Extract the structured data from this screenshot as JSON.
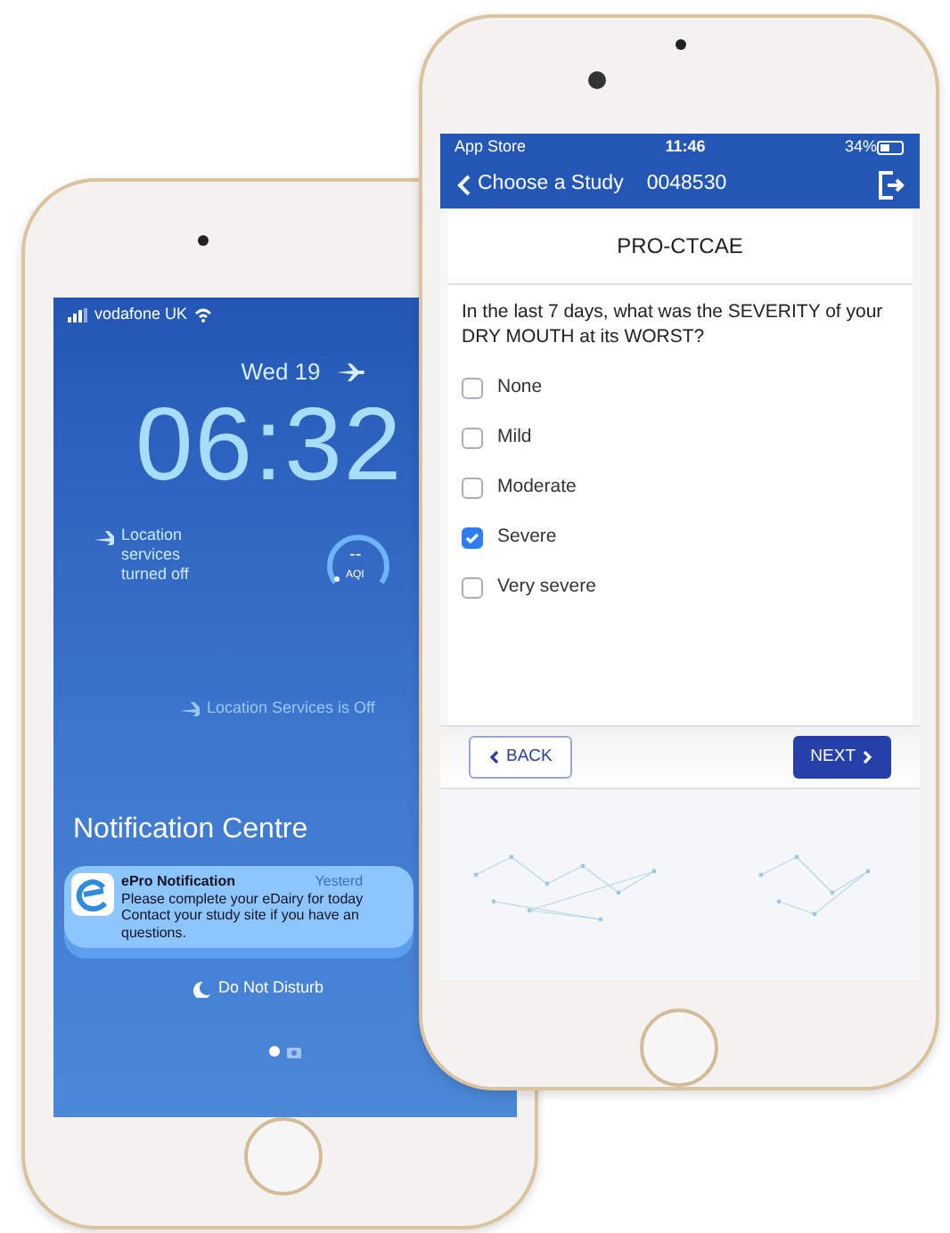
{
  "left_phone": {
    "status_bar": {
      "carrier": "vodafone UK"
    },
    "lock_screen": {
      "date": "Wed 19",
      "time": "06:32",
      "location_notice": "Location services turned off",
      "aqi_gauge": {
        "value": "--",
        "label": "AQI"
      },
      "location_banner": "Location Services is Off"
    },
    "notification_centre": {
      "title": "Notification Centre",
      "notifications": [
        {
          "app": "ePro Notification",
          "time": "Yesterd",
          "lines": [
            "Please complete your eDairy for today",
            "Contact your study site if you have an",
            "questions."
          ]
        }
      ],
      "do_not_disturb": "Do Not Disturb"
    },
    "page_dots": [
      {
        "kind": "dot",
        "selected": true
      },
      {
        "kind": "camera",
        "selected": false
      }
    ]
  },
  "right_phone": {
    "status_bar": {
      "back_app": "App Store",
      "time": "11:46",
      "battery": "34%"
    },
    "nav": {
      "back_label": "Choose a Study",
      "study_id": "0048530"
    },
    "title": "PRO-CTCAE",
    "question": "In the last 7 days, what was the SEVERITY of your DRY MOUTH at its WORST?",
    "options": [
      {
        "label": "None",
        "checked": false
      },
      {
        "label": "Mild",
        "checked": false
      },
      {
        "label": "Moderate",
        "checked": false
      },
      {
        "label": "Severe",
        "checked": true
      },
      {
        "label": "Very severe",
        "checked": false
      }
    ],
    "buttons": {
      "back": "BACK",
      "next": "NEXT"
    }
  }
}
